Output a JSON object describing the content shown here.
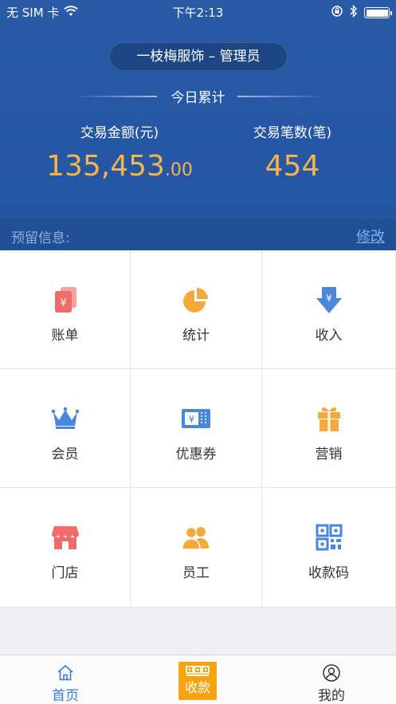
{
  "status_bar": {
    "carrier": "无 SIM 卡",
    "time": "下午2:13"
  },
  "header": {
    "store": "一枝梅服饰 – 管理员",
    "period_label": "今日累计",
    "amount": {
      "label": "交易金额(元)",
      "integer": "135,453",
      "decimal": ".00"
    },
    "count": {
      "label": "交易笔数(笔)",
      "value": "454"
    }
  },
  "reserve": {
    "label": "预留信息:",
    "edit_label": "修改"
  },
  "menu": {
    "items": [
      {
        "label": "账单",
        "icon": "bill-icon",
        "color": "#f26b6b"
      },
      {
        "label": "统计",
        "icon": "pie-chart-icon",
        "color": "#f6a93b"
      },
      {
        "label": "收入",
        "icon": "income-arrow-icon",
        "color": "#4a86d9"
      },
      {
        "label": "会员",
        "icon": "crown-icon",
        "color": "#4a86d9"
      },
      {
        "label": "优惠券",
        "icon": "coupon-icon",
        "color": "#4a86d9"
      },
      {
        "label": "营销",
        "icon": "gift-icon",
        "color": "#f6a93b"
      },
      {
        "label": "门店",
        "icon": "store-icon",
        "color": "#f26b6b"
      },
      {
        "label": "员工",
        "icon": "staff-icon",
        "color": "#f6a93b"
      },
      {
        "label": "收款码",
        "icon": "qr-code-icon",
        "color": "#4a86d9"
      }
    ]
  },
  "tabbar": {
    "home": "首页",
    "collect": "收款",
    "mine": "我的"
  },
  "colors": {
    "header_bg": "#2a5aa6",
    "accent_gold": "#f6b54c",
    "link_blue": "#7ab4f0",
    "collect_orange": "#f6a312"
  }
}
